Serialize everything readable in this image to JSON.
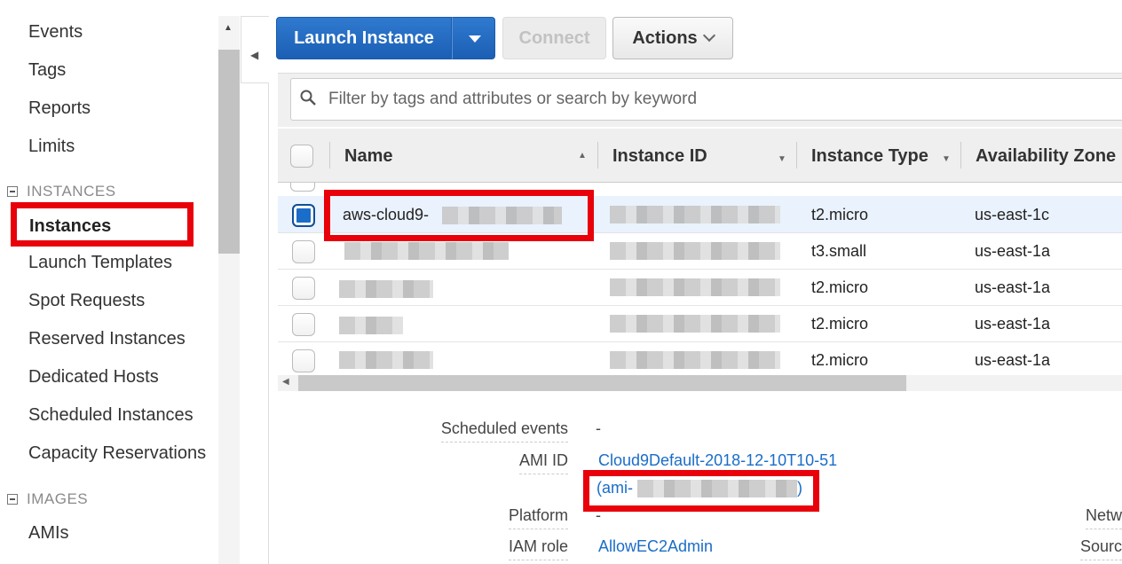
{
  "sidebar": {
    "items_top": [
      "Events",
      "Tags",
      "Reports",
      "Limits"
    ],
    "sections": {
      "instances": {
        "header": "INSTANCES",
        "active": "Instances",
        "items": [
          "Launch Templates",
          "Spot Requests",
          "Reserved Instances",
          "Dedicated Hosts",
          "Scheduled Instances",
          "Capacity Reservations"
        ]
      },
      "images": {
        "header": "IMAGES",
        "items": [
          "AMIs"
        ]
      }
    }
  },
  "toolbar": {
    "launch_label": "Launch Instance",
    "connect_label": "Connect",
    "actions_label": "Actions"
  },
  "filter": {
    "placeholder": "Filter by tags and attributes or search by keyword"
  },
  "table": {
    "columns": [
      "Name",
      "Instance ID",
      "Instance Type",
      "Availability Zone"
    ],
    "rows": [
      {
        "name": "aws-cloud9-",
        "type": "t2.micro",
        "zone": "us-east-1c",
        "selected": true
      },
      {
        "name": "",
        "type": "t3.small",
        "zone": "us-east-1a",
        "selected": false
      },
      {
        "name": "",
        "type": "t2.micro",
        "zone": "us-east-1a",
        "selected": false
      },
      {
        "name": "",
        "type": "t2.micro",
        "zone": "us-east-1a",
        "selected": false
      },
      {
        "name": "",
        "type": "t2.micro",
        "zone": "us-east-1a",
        "selected": false
      }
    ]
  },
  "details": {
    "scheduled_events_label": "Scheduled events",
    "scheduled_events_value": "-",
    "ami_id_label": "AMI ID",
    "ami_id_value": "Cloud9Default-2018-12-10T10-51",
    "ami_id_suffix_open": "(ami-",
    "ami_id_suffix_close": ")",
    "platform_label": "Platform",
    "platform_value": "-",
    "iam_role_label": "IAM role",
    "iam_role_value": "AllowEC2Admin",
    "right_label_1": "Netw",
    "right_label_2": "Sourc"
  },
  "colors": {
    "primary": "#1b5fb4",
    "highlight": "#e8000b",
    "link": "#1a6dc8"
  }
}
